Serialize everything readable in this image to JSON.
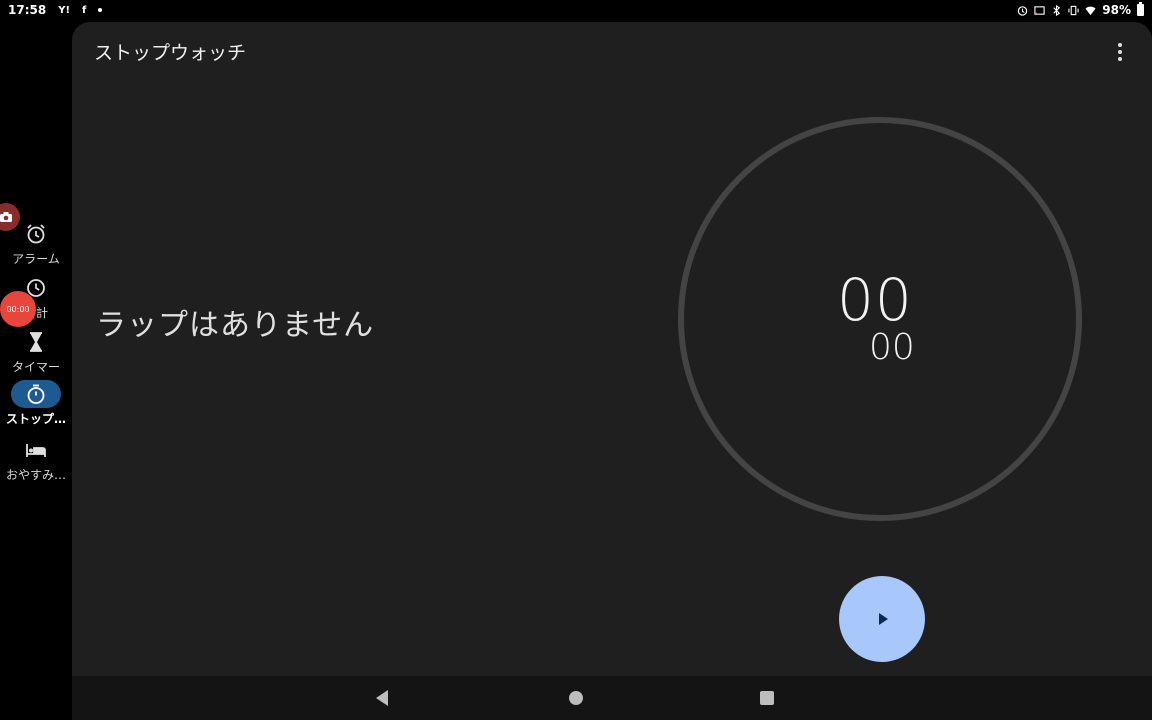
{
  "status_bar": {
    "time": "17:58",
    "app_icons": [
      "Y!",
      "f"
    ],
    "battery": "98%"
  },
  "rail": {
    "items": [
      {
        "label": "アラーム",
        "icon": "alarm-icon"
      },
      {
        "label": "時計",
        "icon": "clock-icon"
      },
      {
        "label": "タイマー",
        "icon": "hourglass-icon"
      },
      {
        "label": "ストップ…",
        "icon": "stopwatch-icon"
      },
      {
        "label": "おやすみ…",
        "icon": "bed-icon"
      }
    ],
    "floating_timer": "00:00"
  },
  "header": {
    "title": "ストップウォッチ"
  },
  "main": {
    "empty_laps": "ラップはありません",
    "seconds": "00",
    "hundredths": "00"
  },
  "colors": {
    "accent": "#a8c7fa",
    "active_rail": "#1d5a8f",
    "panel": "#1f1f1f"
  }
}
